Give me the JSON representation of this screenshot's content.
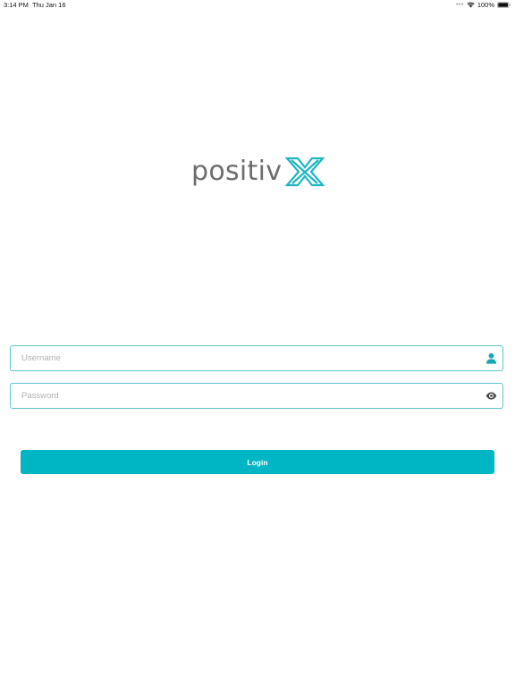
{
  "status_bar": {
    "time": "3:14 PM",
    "date": "Thu Jan 16",
    "battery": "100%",
    "icons": [
      "wifi-icon",
      "battery-icon"
    ]
  },
  "logo": {
    "word": "positiv",
    "mark": "X",
    "colors": {
      "word": "#6d6d6d",
      "mark": "#1eb6c1"
    }
  },
  "login_form": {
    "username": {
      "value": "",
      "placeholder": "Username",
      "icon": "user-icon"
    },
    "password": {
      "value": "",
      "placeholder": "Password",
      "icon": "eye-icon"
    },
    "login_label": "Login"
  },
  "colors": {
    "accent": "#00b6c4",
    "field_border": "#5fc6cc",
    "placeholder": "#b3b3b3"
  }
}
